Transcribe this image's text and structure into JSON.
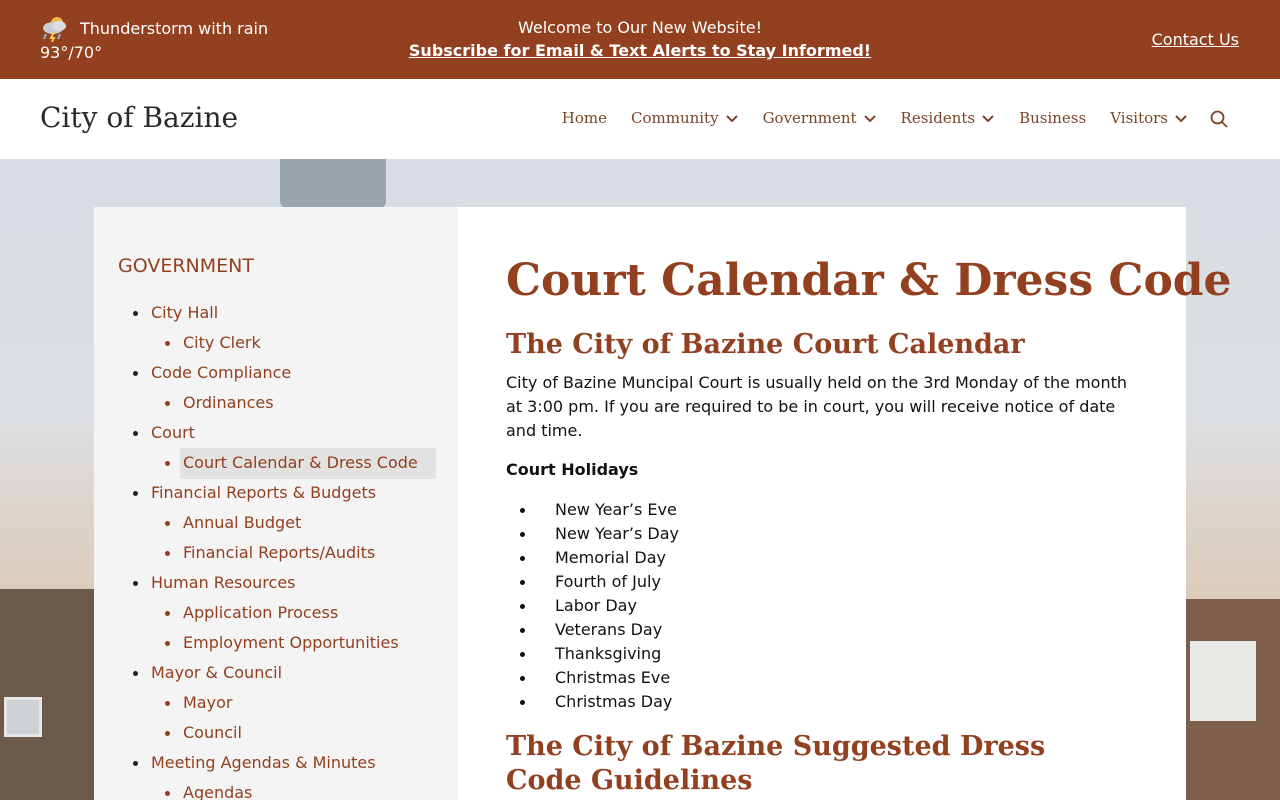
{
  "topbar": {
    "weather_icon": "thunderstorm-rain-icon",
    "weather_desc": "Thunderstorm with rain",
    "weather_temp": "93°/70°",
    "announce_line1": "Welcome to Our New Website!",
    "announce_line2": "Subscribe for Email & Text Alerts to Stay Informed!",
    "contact_label": "Contact Us",
    "bg_color": "#92401f"
  },
  "header": {
    "site_title": "City of Bazine",
    "nav": [
      {
        "label": "Home",
        "dropdown": false
      },
      {
        "label": "Community",
        "dropdown": true
      },
      {
        "label": "Government",
        "dropdown": true
      },
      {
        "label": "Residents",
        "dropdown": true
      },
      {
        "label": "Business",
        "dropdown": false
      },
      {
        "label": "Visitors",
        "dropdown": true
      }
    ],
    "search_icon": "search-icon"
  },
  "sidebar": {
    "heading": "GOVERNMENT",
    "items": [
      {
        "label": "City Hall",
        "level": 1
      },
      {
        "label": "City Clerk",
        "level": 2
      },
      {
        "label": "Code Compliance",
        "level": 1
      },
      {
        "label": "Ordinances",
        "level": 2
      },
      {
        "label": "Court",
        "level": 1
      },
      {
        "label": "Court Calendar & Dress Code",
        "level": 2,
        "active": true
      },
      {
        "label": "Financial Reports & Budgets",
        "level": 1
      },
      {
        "label": "Annual Budget",
        "level": 2
      },
      {
        "label": "Financial Reports/Audits",
        "level": 2
      },
      {
        "label": "Human Resources",
        "level": 1
      },
      {
        "label": "Application Process",
        "level": 2
      },
      {
        "label": "Employment Opportunities",
        "level": 2
      },
      {
        "label": "Mayor & Council",
        "level": 1
      },
      {
        "label": "Mayor",
        "level": 2
      },
      {
        "label": "Council",
        "level": 2
      },
      {
        "label": "Meeting Agendas & Minutes",
        "level": 1
      },
      {
        "label": "Agendas",
        "level": 2
      }
    ]
  },
  "main": {
    "title": "Court Calendar & Dress Code",
    "section1_heading": "The City of Bazine Court Calendar",
    "intro": "City of Bazine Muncipal Court is usually held on the 3rd Monday of the month at 3:00 pm. If you are required to be in court, you will receive notice of date and time.",
    "holidays_label": "Court Holidays",
    "holidays": [
      "New Year’s Eve",
      "New Year’s Day",
      "Memorial Day",
      "Fourth of July",
      "Labor Day",
      "Veterans Day",
      "Thanksgiving",
      "Christmas Eve",
      "Christmas Day"
    ],
    "section2_heading": "The City of Bazine Suggested Dress Code Guidelines"
  }
}
